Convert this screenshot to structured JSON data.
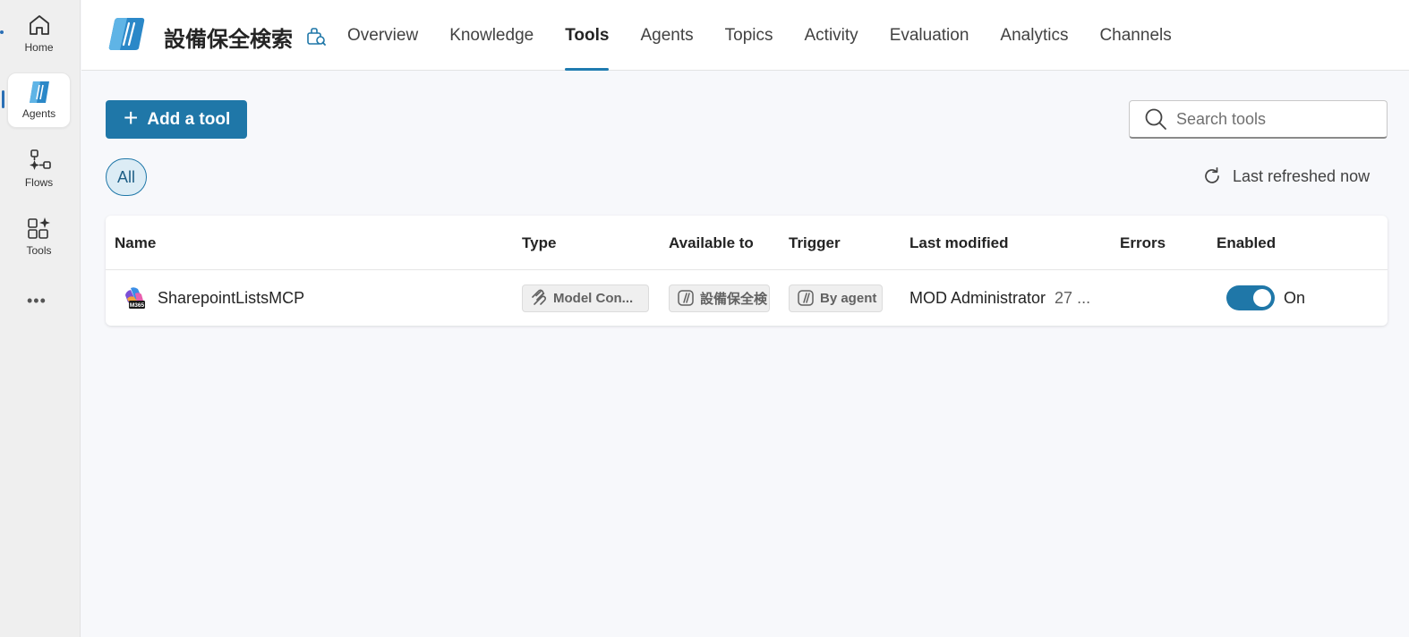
{
  "rail": {
    "items": [
      {
        "label": "Home",
        "icon": "home-icon"
      },
      {
        "label": "Agents",
        "icon": "agents-icon"
      },
      {
        "label": "Flows",
        "icon": "flows-icon"
      },
      {
        "label": "Tools",
        "icon": "tools-icon"
      }
    ],
    "more": "•••"
  },
  "header": {
    "agent_name": "設備保全検索",
    "tabs": [
      {
        "label": "Overview"
      },
      {
        "label": "Knowledge"
      },
      {
        "label": "Tools",
        "active": true
      },
      {
        "label": "Agents"
      },
      {
        "label": "Topics"
      },
      {
        "label": "Activity"
      },
      {
        "label": "Evaluation"
      },
      {
        "label": "Analytics"
      },
      {
        "label": "Channels"
      }
    ]
  },
  "toolbar": {
    "add_label": "Add a tool",
    "search_placeholder": "Search tools",
    "filter_all": "All",
    "refresh_text": "Last refreshed now"
  },
  "table": {
    "columns": [
      "Name",
      "Type",
      "Available to",
      "Trigger",
      "Last modified",
      "Errors",
      "Enabled"
    ],
    "rows": [
      {
        "name": "SharepointListsMCP",
        "type": "Model Con...",
        "available_to": "設備保全検",
        "trigger": "By agent",
        "modified_by": "MOD Administrator",
        "modified_date": "27 ...",
        "errors": "",
        "enabled_label": "On",
        "enabled": true
      }
    ]
  },
  "colors": {
    "accent": "#1f77a8",
    "tab_underline": "#1f7bb0",
    "chip_bg": "#dcecf5"
  }
}
